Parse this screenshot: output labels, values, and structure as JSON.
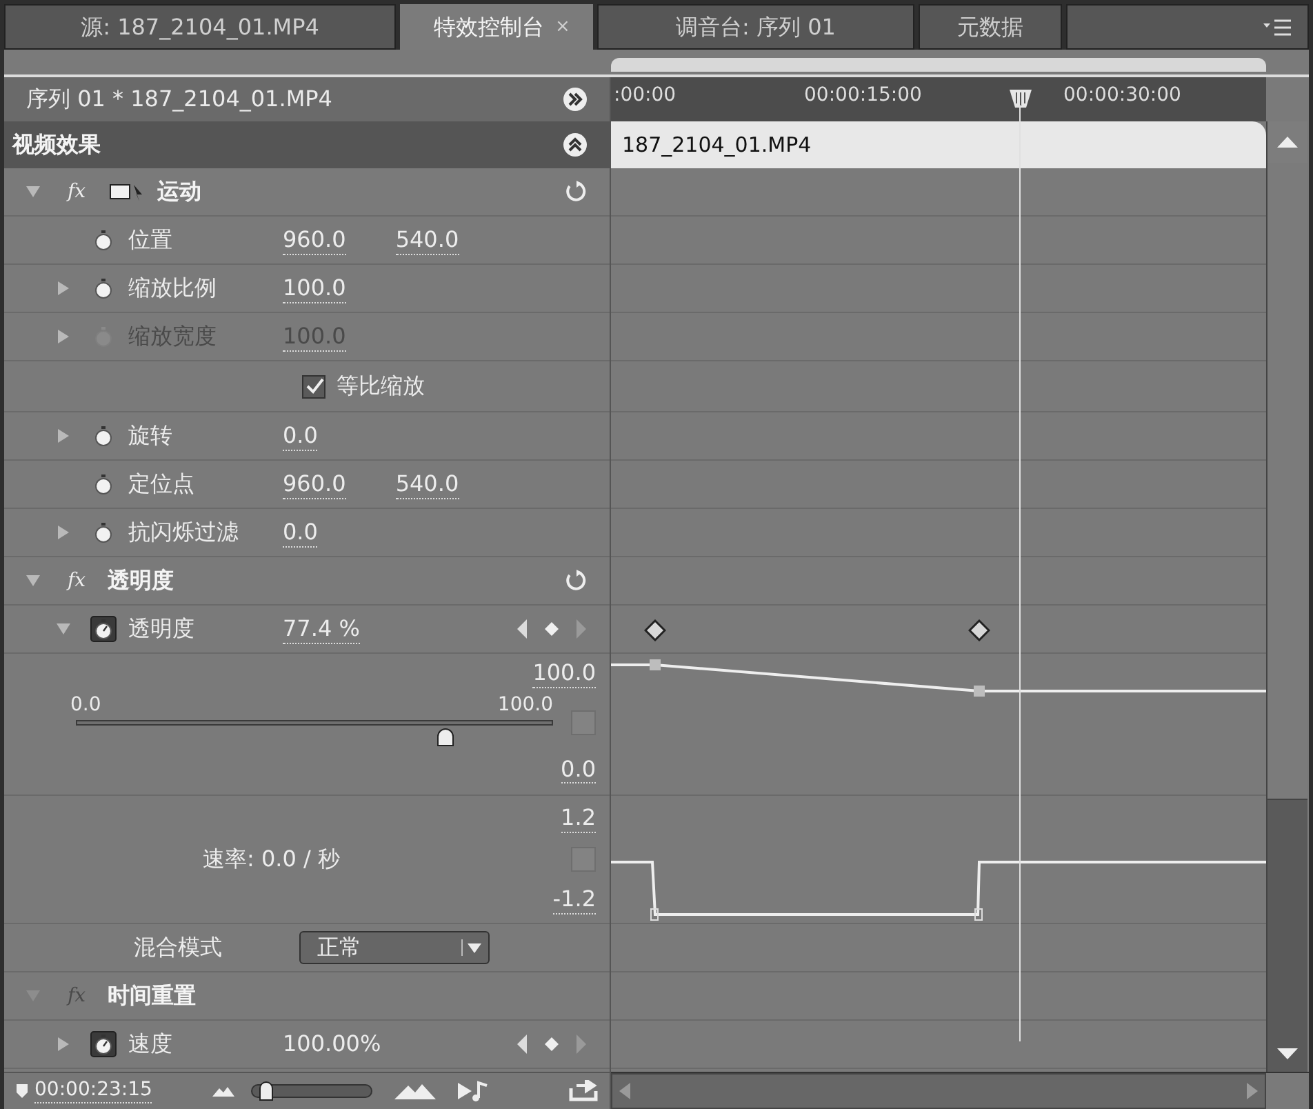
{
  "tabs": [
    {
      "label": "源: 187_2104_01.MP4",
      "selected": false
    },
    {
      "label": "特效控制台",
      "selected": true,
      "close": "×"
    },
    {
      "label": "调音台: 序列 01",
      "selected": false
    },
    {
      "label": "元数据",
      "selected": false
    }
  ],
  "panel_header": {
    "title": "序列 01 * 187_2104_01.MP4"
  },
  "section": {
    "title": "视频效果"
  },
  "ruler": {
    "labels": [
      ":00:00",
      "00:00:15:00",
      "00:00:30:00"
    ]
  },
  "clip": {
    "name": "187_2104_01.MP4"
  },
  "effects": [
    {
      "name": "运动",
      "fx": "fx",
      "fx_enabled": true,
      "expanded": true,
      "has_icon": true,
      "rows": [
        {
          "kind": "value",
          "name": "位置",
          "values": [
            "960.0",
            "540.0"
          ],
          "expandable": false,
          "disabled": false,
          "animating": false
        },
        {
          "kind": "value",
          "name": "缩放比例",
          "values": [
            "100.0"
          ],
          "expandable": true,
          "expanded": false,
          "disabled": false,
          "animating": false
        },
        {
          "kind": "value",
          "name": "缩放宽度",
          "values": [
            "100.0"
          ],
          "expandable": true,
          "expanded": false,
          "disabled": true,
          "animating": false
        },
        {
          "kind": "checkbox",
          "label": "等比缩放",
          "checked": true
        },
        {
          "kind": "value",
          "name": "旋转",
          "values": [
            "0.0"
          ],
          "expandable": true,
          "expanded": false,
          "disabled": false,
          "animating": false
        },
        {
          "kind": "value",
          "name": "定位点",
          "values": [
            "960.0",
            "540.0"
          ],
          "expandable": false,
          "disabled": false,
          "animating": false
        },
        {
          "kind": "value",
          "name": "抗闪烁过滤",
          "values": [
            "0.0"
          ],
          "expandable": true,
          "expanded": false,
          "disabled": false,
          "animating": false
        }
      ]
    },
    {
      "name": "透明度",
      "fx": "fx",
      "fx_enabled": true,
      "expanded": true,
      "has_icon": false,
      "rows": [
        {
          "kind": "value",
          "name": "透明度",
          "values": [
            "77.4 %"
          ],
          "expandable": true,
          "expanded": true,
          "disabled": false,
          "animating": true
        },
        {
          "kind": "value_graph",
          "max": "100.0",
          "min": "0.0",
          "slider_min": "0.0",
          "slider_max": "100.0",
          "level": 0.774
        },
        {
          "kind": "velocity_graph",
          "max": "1.2",
          "min": "-1.2",
          "rate": "速率: 0.0 / 秒"
        },
        {
          "kind": "dropdown",
          "name": "混合模式",
          "value": "正常"
        }
      ]
    },
    {
      "name": "时间重置",
      "fx": "fx",
      "fx_enabled": false,
      "expanded": true,
      "has_icon": false,
      "rows": [
        {
          "kind": "plain",
          "name": "速度",
          "values": [
            "100.00%"
          ],
          "expandable": true,
          "expanded": false,
          "disabled": false,
          "animating": true
        }
      ]
    }
  ],
  "footer": {
    "timecode": "00:00:23:15",
    "zoom": {
      "level": 0.05
    }
  }
}
